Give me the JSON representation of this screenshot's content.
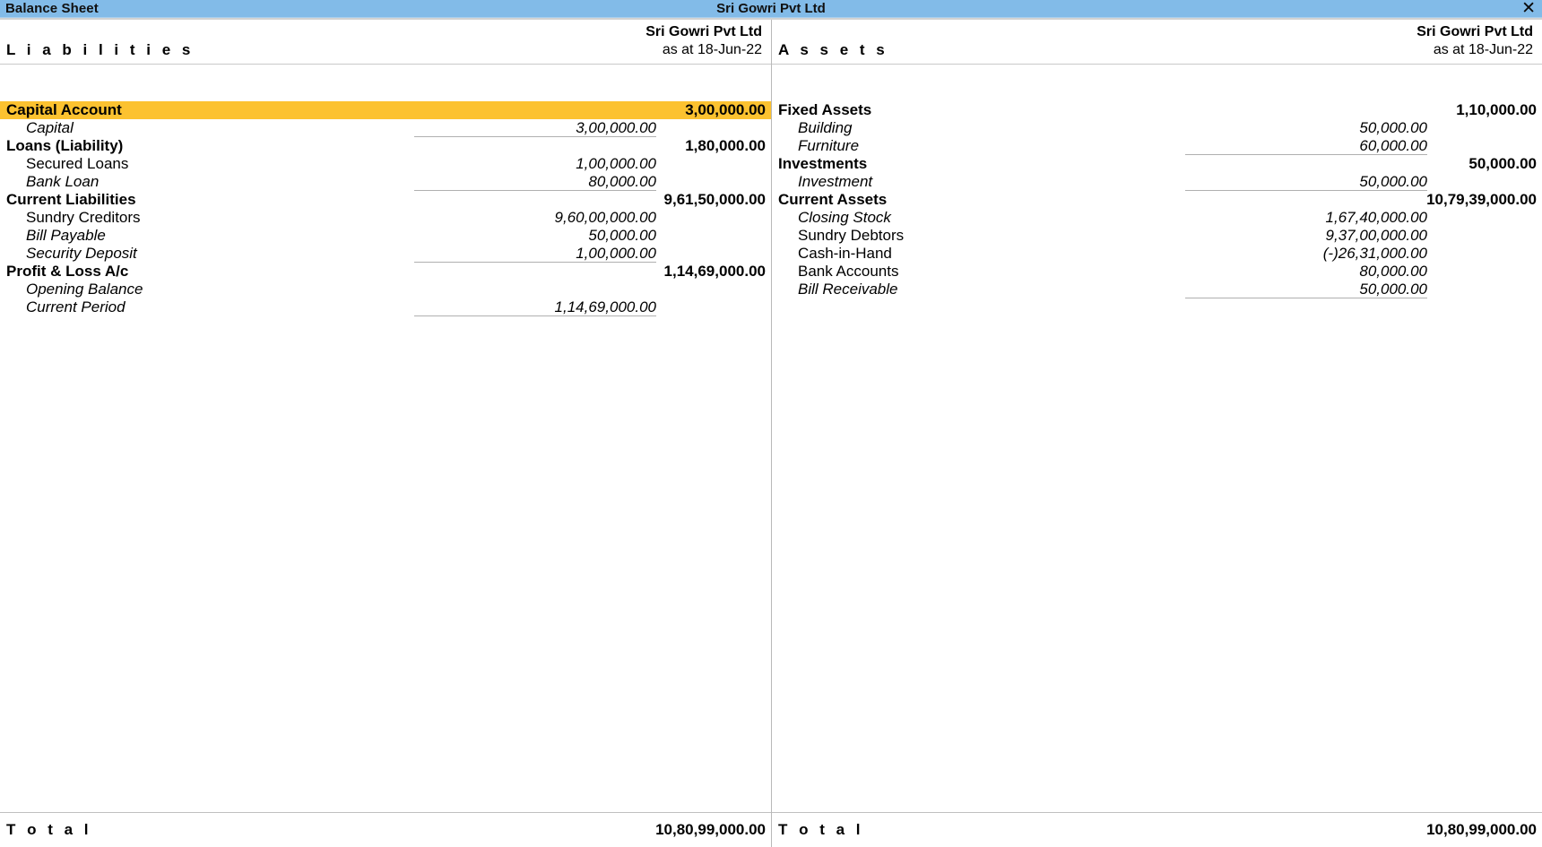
{
  "titlebar": {
    "left_title": "Balance Sheet",
    "center_title": "Sri Gowri Pvt Ltd",
    "close_icon": "close-icon",
    "close_glyph": "✕",
    "bar_color": "#82bbe8"
  },
  "highlight_color": "#fcc230",
  "liabilities": {
    "column_title": "L i a b i l i t i e s",
    "company": "Sri Gowri Pvt Ltd",
    "as_at": "as at 18-Jun-22",
    "groups": [
      {
        "name": "Capital Account",
        "amount": "3,00,000.00",
        "highlighted": true,
        "items": [
          {
            "name": "Capital",
            "amount": "3,00,000.00",
            "italic": true,
            "ruled": true
          }
        ]
      },
      {
        "name": "Loans (Liability)",
        "amount": "1,80,000.00",
        "highlighted": false,
        "items": [
          {
            "name": "Secured Loans",
            "amount": "1,00,000.00",
            "italic": false,
            "ruled": false
          },
          {
            "name": "Bank Loan",
            "amount": "80,000.00",
            "italic": true,
            "ruled": true
          }
        ]
      },
      {
        "name": "Current Liabilities",
        "amount": "9,61,50,000.00",
        "highlighted": false,
        "items": [
          {
            "name": "Sundry Creditors",
            "amount": "9,60,00,000.00",
            "italic": false,
            "ruled": false
          },
          {
            "name": "Bill Payable",
            "amount": "50,000.00",
            "italic": true,
            "ruled": false
          },
          {
            "name": "Security Deposit",
            "amount": "1,00,000.00",
            "italic": true,
            "ruled": true
          }
        ]
      },
      {
        "name": "Profit & Loss A/c",
        "amount": "1,14,69,000.00",
        "highlighted": false,
        "items": [
          {
            "name": "Opening Balance",
            "amount": "",
            "italic": true,
            "ruled": false
          },
          {
            "name": "Current Period",
            "amount": "1,14,69,000.00",
            "italic": true,
            "ruled": true
          }
        ]
      }
    ],
    "total_label": "T o t a l",
    "total_amount": "10,80,99,000.00"
  },
  "assets": {
    "column_title": "A s s e t s",
    "company": "Sri Gowri Pvt Ltd",
    "as_at": "as at 18-Jun-22",
    "groups": [
      {
        "name": "Fixed Assets",
        "amount": "1,10,000.00",
        "highlighted": false,
        "items": [
          {
            "name": "Building",
            "amount": "50,000.00",
            "italic": true,
            "ruled": false
          },
          {
            "name": "Furniture",
            "amount": "60,000.00",
            "italic": true,
            "ruled": true
          }
        ]
      },
      {
        "name": "Investments",
        "amount": "50,000.00",
        "highlighted": false,
        "items": [
          {
            "name": "Investment",
            "amount": "50,000.00",
            "italic": true,
            "ruled": true
          }
        ]
      },
      {
        "name": "Current Assets",
        "amount": "10,79,39,000.00",
        "highlighted": false,
        "items": [
          {
            "name": "Closing Stock",
            "amount": "1,67,40,000.00",
            "italic": true,
            "ruled": false
          },
          {
            "name": "Sundry Debtors",
            "amount": "9,37,00,000.00",
            "italic": false,
            "ruled": false
          },
          {
            "name": "Cash-in-Hand",
            "amount": "(-)26,31,000.00",
            "italic": false,
            "ruled": false
          },
          {
            "name": "Bank Accounts",
            "amount": "80,000.00",
            "italic": false,
            "ruled": false
          },
          {
            "name": "Bill Receivable",
            "amount": "50,000.00",
            "italic": true,
            "ruled": true
          }
        ]
      }
    ],
    "total_label": "T o t a l",
    "total_amount": "10,80,99,000.00"
  }
}
